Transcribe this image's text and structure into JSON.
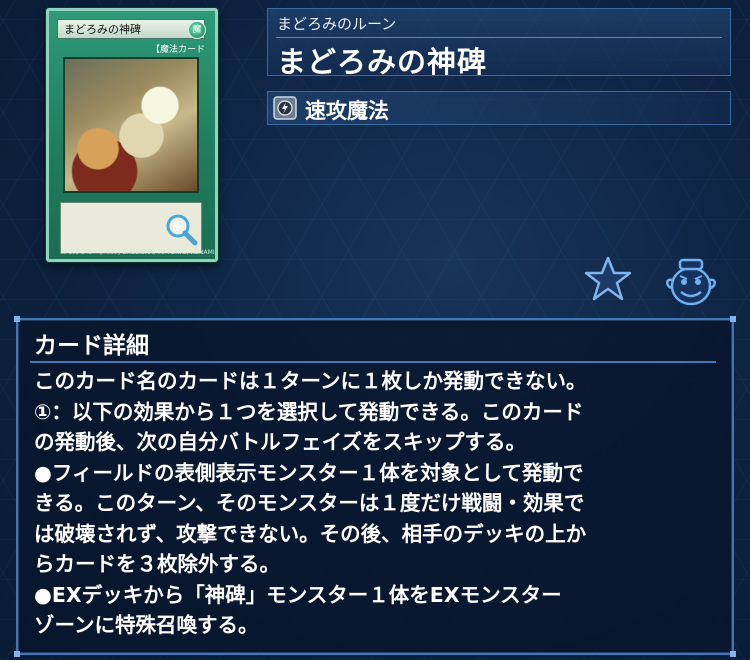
{
  "card": {
    "thumb_name": "まどろみの神碑",
    "thumb_type_line": "【魔法カード",
    "attribute_glyph": "魔",
    "footer": "© スタジオ・ダイス / SHUEISHA, TV TOKYO, KONAMI"
  },
  "header": {
    "ruby": "まどろみのルーン",
    "title": "まどろみの神碑"
  },
  "type_row": {
    "icon": "quick-play-spell-icon",
    "label": "速攻魔法"
  },
  "actions": {
    "favorite_icon": "star-icon",
    "pot_icon": "pot-of-greed-icon"
  },
  "details": {
    "heading": "カード詳細",
    "lines": [
      "このカード名のカードは１ターンに１枚しか発動できない。",
      "①：以下の効果から１つを選択して発動できる。このカード",
      "の発動後、次の自分バトルフェイズをスキップする。",
      "●フィールドの表側表示モンスター１体を対象として発動で",
      "きる。このターン、そのモンスターは１度だけ戦闘・効果で",
      "は破壊されず、攻撃できない。その後、相手のデッキの上か",
      "らカードを３枚除外する。",
      "●EXデッキから「神碑」モンスター１体をEXモンスター",
      "ゾーンに特殊召喚する。"
    ]
  },
  "colors": {
    "background": "#0d2240",
    "panel_border": "#3f78b8",
    "spell_card_green": "#1f7b5c"
  }
}
